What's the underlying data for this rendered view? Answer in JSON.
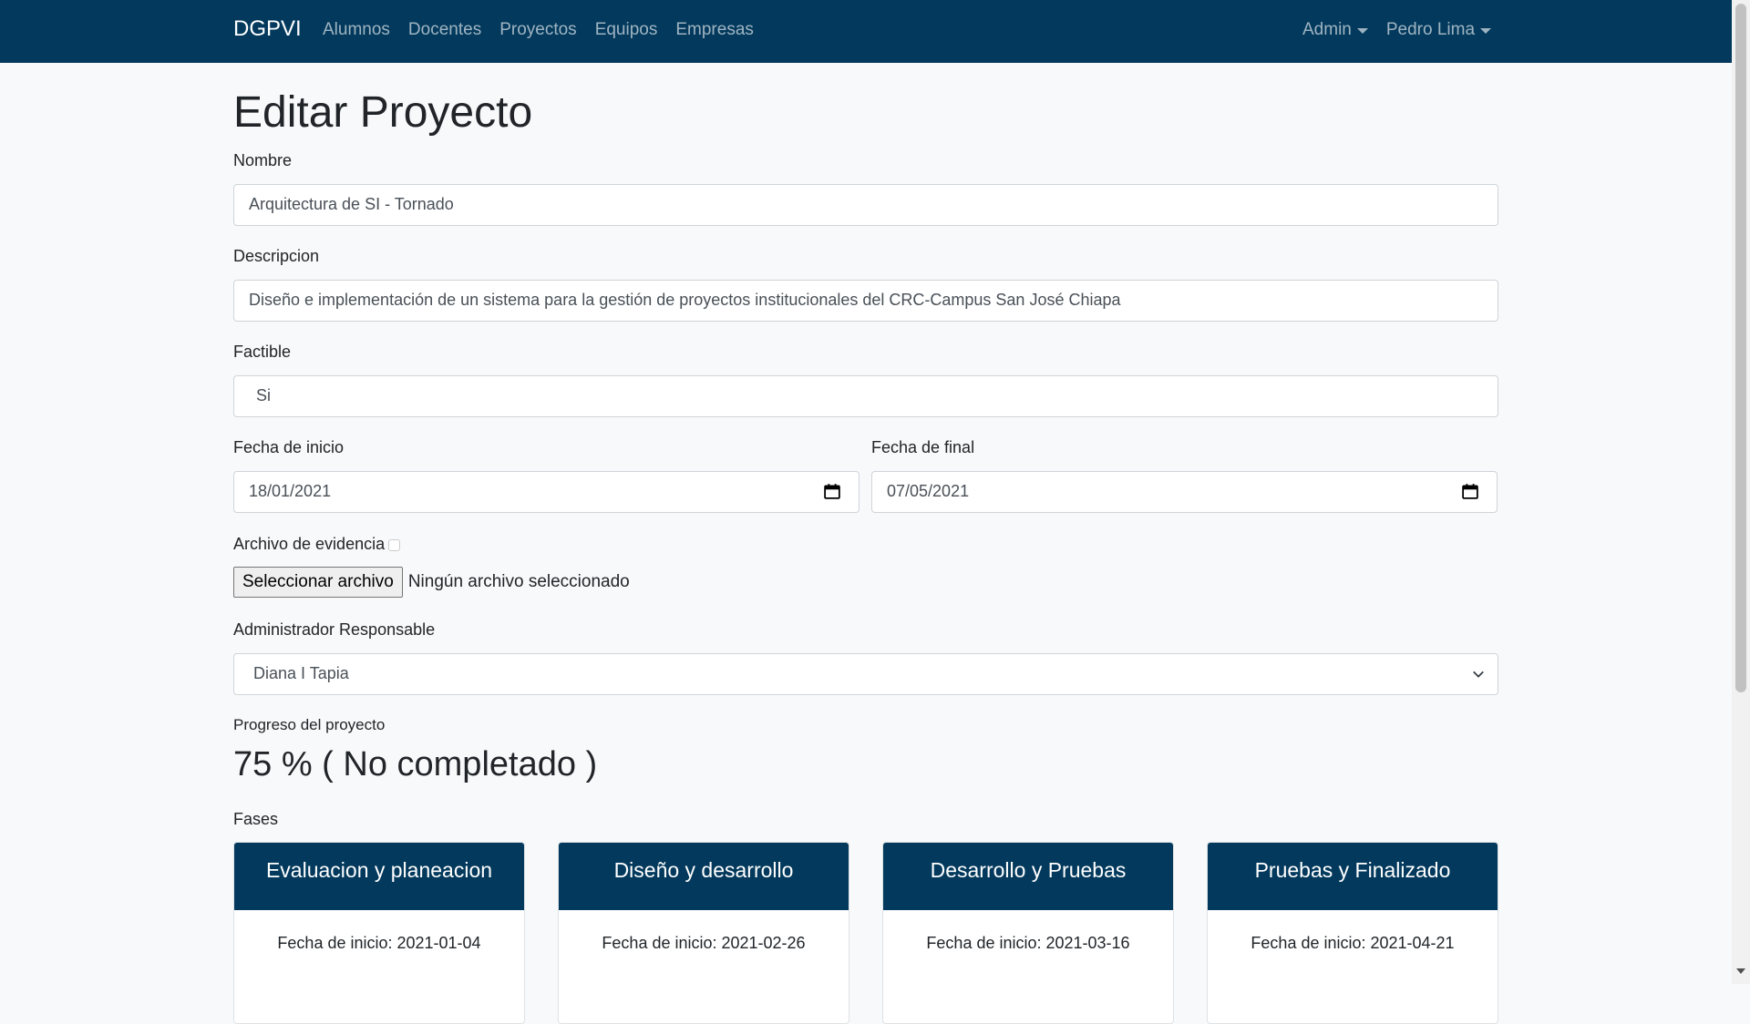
{
  "navbar": {
    "brand": "DGPVI",
    "links": [
      "Alumnos",
      "Docentes",
      "Proyectos",
      "Equipos",
      "Empresas"
    ],
    "admin_menu": "Admin",
    "user_menu": "Pedro Lima"
  },
  "page": {
    "title": "Editar Proyecto"
  },
  "form": {
    "nombre_label": "Nombre",
    "nombre_value": "Arquitectura de SI - Tornado",
    "descripcion_label": "Descripcion",
    "descripcion_value": "Diseño e implementación de un sistema para la gestión de proyectos institucionales del CRC-Campus San José Chiapa",
    "factible_label": "Factible",
    "factible_value": "Si",
    "fecha_inicio_label": "Fecha de inicio",
    "fecha_inicio_value": "18/01/2021",
    "fecha_final_label": "Fecha de final",
    "fecha_final_value": "07/05/2021",
    "archivo_label": "Archivo de evidencia",
    "archivo_button": "Seleccionar archivo",
    "archivo_status": "Ningún archivo seleccionado",
    "admin_label": "Administrador Responsable",
    "admin_value": "Diana I Tapia",
    "progreso_label": "Progreso del proyecto",
    "progreso_value": "75 % ( No completado )",
    "fases_label": "Fases"
  },
  "phases": [
    {
      "title": "Evaluacion y planeacion",
      "start": "Fecha de inicio: 2021-01-04"
    },
    {
      "title": "Diseño y desarrollo",
      "start": "Fecha de inicio: 2021-02-26"
    },
    {
      "title": "Desarrollo y Pruebas",
      "start": "Fecha de inicio: 2021-03-16"
    },
    {
      "title": "Pruebas y Finalizado",
      "start": "Fecha de inicio: 2021-04-21"
    }
  ],
  "colors": {
    "navbar": "#02395c",
    "background": "#f8f9fa"
  }
}
